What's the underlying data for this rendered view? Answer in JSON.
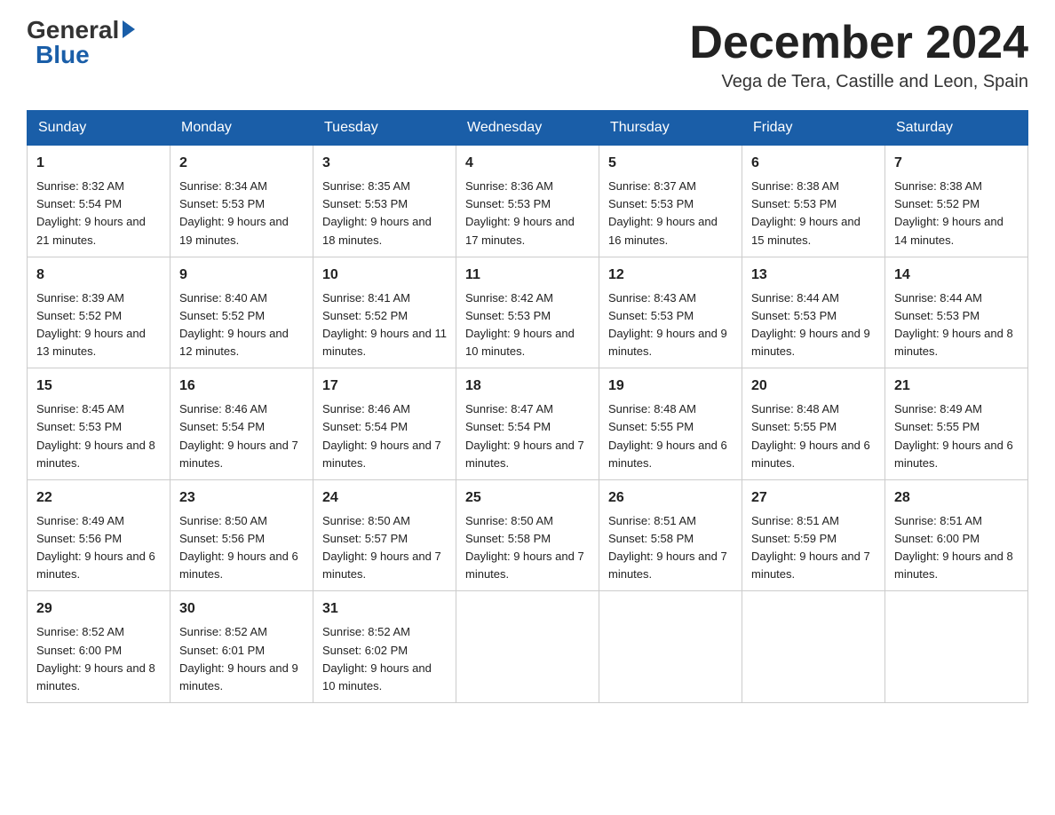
{
  "header": {
    "logo_general": "General",
    "logo_blue": "Blue",
    "month_title": "December 2024",
    "location": "Vega de Tera, Castille and Leon, Spain"
  },
  "days_of_week": [
    "Sunday",
    "Monday",
    "Tuesday",
    "Wednesday",
    "Thursday",
    "Friday",
    "Saturday"
  ],
  "weeks": [
    [
      {
        "day": "1",
        "sunrise": "8:32 AM",
        "sunset": "5:54 PM",
        "daylight": "9 hours and 21 minutes."
      },
      {
        "day": "2",
        "sunrise": "8:34 AM",
        "sunset": "5:53 PM",
        "daylight": "9 hours and 19 minutes."
      },
      {
        "day": "3",
        "sunrise": "8:35 AM",
        "sunset": "5:53 PM",
        "daylight": "9 hours and 18 minutes."
      },
      {
        "day": "4",
        "sunrise": "8:36 AM",
        "sunset": "5:53 PM",
        "daylight": "9 hours and 17 minutes."
      },
      {
        "day": "5",
        "sunrise": "8:37 AM",
        "sunset": "5:53 PM",
        "daylight": "9 hours and 16 minutes."
      },
      {
        "day": "6",
        "sunrise": "8:38 AM",
        "sunset": "5:53 PM",
        "daylight": "9 hours and 15 minutes."
      },
      {
        "day": "7",
        "sunrise": "8:38 AM",
        "sunset": "5:52 PM",
        "daylight": "9 hours and 14 minutes."
      }
    ],
    [
      {
        "day": "8",
        "sunrise": "8:39 AM",
        "sunset": "5:52 PM",
        "daylight": "9 hours and 13 minutes."
      },
      {
        "day": "9",
        "sunrise": "8:40 AM",
        "sunset": "5:52 PM",
        "daylight": "9 hours and 12 minutes."
      },
      {
        "day": "10",
        "sunrise": "8:41 AM",
        "sunset": "5:52 PM",
        "daylight": "9 hours and 11 minutes."
      },
      {
        "day": "11",
        "sunrise": "8:42 AM",
        "sunset": "5:53 PM",
        "daylight": "9 hours and 10 minutes."
      },
      {
        "day": "12",
        "sunrise": "8:43 AM",
        "sunset": "5:53 PM",
        "daylight": "9 hours and 9 minutes."
      },
      {
        "day": "13",
        "sunrise": "8:44 AM",
        "sunset": "5:53 PM",
        "daylight": "9 hours and 9 minutes."
      },
      {
        "day": "14",
        "sunrise": "8:44 AM",
        "sunset": "5:53 PM",
        "daylight": "9 hours and 8 minutes."
      }
    ],
    [
      {
        "day": "15",
        "sunrise": "8:45 AM",
        "sunset": "5:53 PM",
        "daylight": "9 hours and 8 minutes."
      },
      {
        "day": "16",
        "sunrise": "8:46 AM",
        "sunset": "5:54 PM",
        "daylight": "9 hours and 7 minutes."
      },
      {
        "day": "17",
        "sunrise": "8:46 AM",
        "sunset": "5:54 PM",
        "daylight": "9 hours and 7 minutes."
      },
      {
        "day": "18",
        "sunrise": "8:47 AM",
        "sunset": "5:54 PM",
        "daylight": "9 hours and 7 minutes."
      },
      {
        "day": "19",
        "sunrise": "8:48 AM",
        "sunset": "5:55 PM",
        "daylight": "9 hours and 6 minutes."
      },
      {
        "day": "20",
        "sunrise": "8:48 AM",
        "sunset": "5:55 PM",
        "daylight": "9 hours and 6 minutes."
      },
      {
        "day": "21",
        "sunrise": "8:49 AM",
        "sunset": "5:55 PM",
        "daylight": "9 hours and 6 minutes."
      }
    ],
    [
      {
        "day": "22",
        "sunrise": "8:49 AM",
        "sunset": "5:56 PM",
        "daylight": "9 hours and 6 minutes."
      },
      {
        "day": "23",
        "sunrise": "8:50 AM",
        "sunset": "5:56 PM",
        "daylight": "9 hours and 6 minutes."
      },
      {
        "day": "24",
        "sunrise": "8:50 AM",
        "sunset": "5:57 PM",
        "daylight": "9 hours and 7 minutes."
      },
      {
        "day": "25",
        "sunrise": "8:50 AM",
        "sunset": "5:58 PM",
        "daylight": "9 hours and 7 minutes."
      },
      {
        "day": "26",
        "sunrise": "8:51 AM",
        "sunset": "5:58 PM",
        "daylight": "9 hours and 7 minutes."
      },
      {
        "day": "27",
        "sunrise": "8:51 AM",
        "sunset": "5:59 PM",
        "daylight": "9 hours and 7 minutes."
      },
      {
        "day": "28",
        "sunrise": "8:51 AM",
        "sunset": "6:00 PM",
        "daylight": "9 hours and 8 minutes."
      }
    ],
    [
      {
        "day": "29",
        "sunrise": "8:52 AM",
        "sunset": "6:00 PM",
        "daylight": "9 hours and 8 minutes."
      },
      {
        "day": "30",
        "sunrise": "8:52 AM",
        "sunset": "6:01 PM",
        "daylight": "9 hours and 9 minutes."
      },
      {
        "day": "31",
        "sunrise": "8:52 AM",
        "sunset": "6:02 PM",
        "daylight": "9 hours and 10 minutes."
      },
      null,
      null,
      null,
      null
    ]
  ]
}
